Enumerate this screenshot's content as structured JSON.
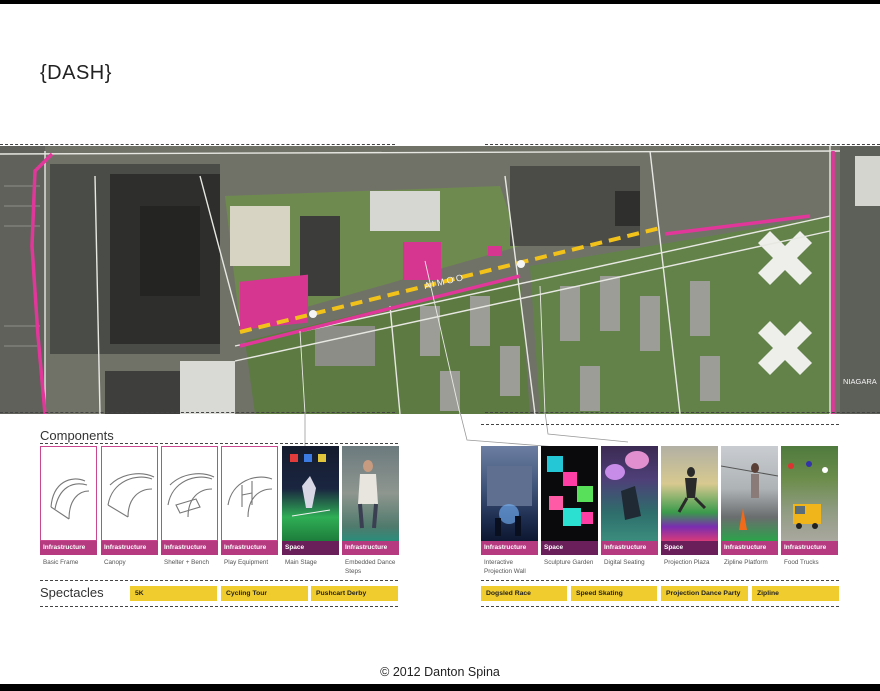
{
  "page": {
    "title": "{DASH}",
    "copyright": "© 2012 Danton Spina"
  },
  "map": {
    "street_label": "NIAGARA"
  },
  "components": {
    "label": "Components",
    "left": [
      {
        "tag": "Infrastructure",
        "caption": "Basic Frame",
        "kind": "sketch"
      },
      {
        "tag": "Infrastructure",
        "caption": "Canopy",
        "kind": "sketch"
      },
      {
        "tag": "Infrastructure",
        "caption": "Shelter + Bench",
        "kind": "sketch"
      },
      {
        "tag": "Infrastructure",
        "caption": "Play Equipment",
        "kind": "sketch"
      },
      {
        "tag": "Space",
        "caption": "Main Stage",
        "kind": "photo"
      },
      {
        "tag": "Infrastructure",
        "caption": "Embedded Dance Steps",
        "kind": "photo"
      }
    ],
    "right": [
      {
        "tag": "Infrastructure",
        "caption": "Interactive Projection Wall"
      },
      {
        "tag": "Space",
        "caption": "Sculpture Garden"
      },
      {
        "tag": "Infrastructure",
        "caption": "Digital Seating"
      },
      {
        "tag": "Space",
        "caption": "Projection Plaza"
      },
      {
        "tag": "Infrastructure",
        "caption": "Zipline Platform"
      },
      {
        "tag": "Infrastructure",
        "caption": "Food Trucks"
      }
    ]
  },
  "spectacles": {
    "label": "Spectacles",
    "items": [
      "5K",
      "Cycling Tour",
      "Pushcart Derby",
      "Dogsled Race",
      "Speed Skating",
      "Projection Dance Party",
      "Zipline"
    ]
  },
  "colors": {
    "magenta": "#d6368f",
    "infra_tag": "#b53a80",
    "space_tag": "#6b1f5a",
    "spectacle": "#f0cc2e",
    "route": "#f3c21a"
  }
}
